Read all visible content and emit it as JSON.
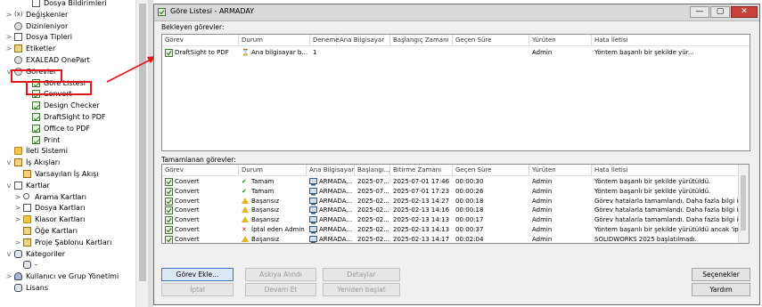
{
  "tree": {
    "items": [
      {
        "name": "dosya-bildirimleri",
        "label": "Dosya Bildirimleri",
        "arrow": "",
        "icon": "ic-page",
        "icon_name": "file-notifications-icon"
      },
      {
        "name": "degiskenler",
        "label": "Değişkenler",
        "arrow": ">",
        "icon": "ic-var",
        "icon_name": "variables-icon",
        "glyph": "(x)"
      },
      {
        "name": "dizinleniyor",
        "label": "Dizinleniyor",
        "arrow": "",
        "icon": "ic-gear",
        "icon_name": "indexing-icon"
      },
      {
        "name": "dosya-tipleri",
        "label": "Dosya Tipleri",
        "arrow": ">",
        "icon": "ic-page",
        "icon_name": "file-types-icon"
      },
      {
        "name": "etiketler",
        "label": "Etiketler",
        "arrow": ">",
        "icon": "ic-card",
        "icon_name": "labels-icon"
      },
      {
        "name": "exalead",
        "label": "EXALEAD OnePart",
        "arrow": "",
        "icon": "ic-gear",
        "icon_name": "exalead-icon"
      },
      {
        "name": "gorevler",
        "label": "Görevler",
        "arrow": "v",
        "icon": "ic-gear",
        "icon_name": "tasks-gear-icon"
      },
      {
        "name": "gore-listesi",
        "label": "Göre Listesi",
        "arrow": "",
        "icon": "ic-task",
        "icon_name": "task-list-icon"
      },
      {
        "name": "convert",
        "label": "Convert",
        "arrow": "",
        "icon": "ic-task",
        "icon_name": "convert-task-icon"
      },
      {
        "name": "design-checker",
        "label": "Design Checker",
        "arrow": "",
        "icon": "ic-task",
        "icon_name": "design-checker-icon"
      },
      {
        "name": "draftsight-pdf",
        "label": "DraftSight to PDF",
        "arrow": "",
        "icon": "ic-task",
        "icon_name": "draftsight-pdf-icon"
      },
      {
        "name": "office-pdf",
        "label": "Office to PDF",
        "arrow": "",
        "icon": "ic-task",
        "icon_name": "office-pdf-icon"
      },
      {
        "name": "print",
        "label": "Print",
        "arrow": "",
        "icon": "ic-task",
        "icon_name": "print-task-icon"
      },
      {
        "name": "ileti-sistemi",
        "label": "İleti Sistemi",
        "arrow": "",
        "icon": "ic-folder",
        "icon_name": "message-system-icon"
      },
      {
        "name": "is-akislari",
        "label": "İş Akışları",
        "arrow": "v",
        "icon": "ic-flow",
        "icon_name": "workflows-icon"
      },
      {
        "name": "varsayilan-akis",
        "label": "Varsayılan İş Akışı",
        "arrow": "",
        "icon": "ic-flow",
        "icon_name": "default-workflow-icon"
      },
      {
        "name": "kartlar",
        "label": "Kartlar",
        "arrow": "v",
        "icon": "ic-box",
        "icon_name": "cards-icon"
      },
      {
        "name": "arama-kartlari",
        "label": "Arama Kartları",
        "arrow": ">",
        "icon": "ic-search",
        "icon_name": "search-cards-icon"
      },
      {
        "name": "dosya-kartlari",
        "label": "Dosya Kartları",
        "arrow": ">",
        "icon": "ic-page",
        "icon_name": "file-cards-icon"
      },
      {
        "name": "klasor-kartlari",
        "label": "Klasor Kartları",
        "arrow": ">",
        "icon": "ic-folder",
        "icon_name": "folder-cards-icon"
      },
      {
        "name": "oge-kartlari",
        "label": "Öğe Kartları",
        "arrow": "",
        "icon": "ic-card",
        "icon_name": "item-cards-icon"
      },
      {
        "name": "proje-sablonu",
        "label": "Proje Şablonu Kartları",
        "arrow": ">",
        "icon": "ic-card",
        "icon_name": "project-template-icon"
      },
      {
        "name": "kategoriler",
        "label": "Kategoriler",
        "arrow": "v",
        "icon": "ic-db",
        "icon_name": "categories-icon"
      },
      {
        "name": "kategori-dash",
        "label": "-",
        "arrow": "",
        "icon": "ic-db",
        "icon_name": "category-icon"
      },
      {
        "name": "kullanici-grup",
        "label": "Kullanıcı ve Grup Yönetimi",
        "arrow": ">",
        "icon": "ic-user",
        "icon_name": "users-groups-icon"
      },
      {
        "name": "lisans",
        "label": "Lisans",
        "arrow": "",
        "icon": "ic-db",
        "icon_name": "license-icon"
      }
    ]
  },
  "window": {
    "title": "Göre Listesi - ARMADAY",
    "btn_min": "—",
    "btn_max": "▢",
    "btn_close": "✕"
  },
  "pending": {
    "label": "Bekleyen görevler:",
    "columns": [
      "Görev",
      "Durum",
      "Deneme",
      "Ana Bilgisayar",
      "Başlangıç Zamanı",
      "Geçen Süre",
      "Yürüten",
      "Hata İletisi"
    ],
    "rows": [
      {
        "task": "DraftSight to PDF",
        "status": "Ana bilgisayar b...",
        "attempt": "1",
        "host": "",
        "start": "",
        "elapsed": "",
        "user": "Admin",
        "error": "Yöntem başarılı bir şekilde yür..."
      }
    ]
  },
  "completed": {
    "label": "Tamamlanan görevler:",
    "columns": [
      "Görev",
      "Durum",
      "Ana Bilgisayar",
      "Başlangı...",
      "Bitirme Zamanı",
      "Geçen Süre",
      "Yürüten",
      "Hata İletisi"
    ],
    "rows": [
      {
        "task": "Convert",
        "status": "Tamam",
        "kind": "ok",
        "host": "ARMADA...",
        "start": "2025-07...",
        "end": "2025-07-01 17:46",
        "elapsed": "00:00:30",
        "user": "Admin",
        "error": "Yöntem başarılı bir şekilde yürütüldü."
      },
      {
        "task": "Convert",
        "status": "Tamam",
        "kind": "ok",
        "host": "ARMADA...",
        "start": "2025-07...",
        "end": "2025-07-01 17:23",
        "elapsed": "00:00:26",
        "user": "Admin",
        "error": "Yöntem başarılı bir şekilde yürütüldü."
      },
      {
        "task": "Convert",
        "status": "Başarısız",
        "kind": "warn",
        "host": "ARMADA...",
        "start": "2025-02...",
        "end": "2025-02-13 14:27",
        "elapsed": "00:00:18",
        "user": "Admin",
        "error": "Görev hatalarla tamamlandı. Daha fazla bilgi için"
      },
      {
        "task": "Convert",
        "status": "Başarısız",
        "kind": "warn",
        "host": "ARMADA...",
        "start": "2025-02...",
        "end": "2025-02-13 14:16",
        "elapsed": "00:00:18",
        "user": "Admin",
        "error": "Görev hatalarla tamamlandı. Daha fazla bilgi için"
      },
      {
        "task": "Convert",
        "status": "Başarısız",
        "kind": "warn",
        "host": "ARMADA...",
        "start": "2025-02...",
        "end": "2025-02-13 14:13",
        "elapsed": "00:00:17",
        "user": "Admin",
        "error": "Görev hatalarla tamamlandı. Daha fazla bilgi için"
      },
      {
        "task": "Convert",
        "status": "İptal eden Admin",
        "kind": "x",
        "host": "ARMADA...",
        "start": "2025-02...",
        "end": "2025-02-13 14:13",
        "elapsed": "00:00:37",
        "user": "Admin",
        "error": "Yöntem başarılı bir şekilde yürütüldü ancak 'iptal'"
      },
      {
        "task": "Convert",
        "status": "Başarısız",
        "kind": "warn",
        "host": "ARMADA...",
        "start": "2025-02...",
        "end": "2025-02-13 14:17",
        "elapsed": "00:02:04",
        "user": "Admin",
        "error": "SOLIDWORKS 2025 başlatılmadı."
      }
    ]
  },
  "buttons": {
    "gorev_ekle": "Görev Ekle...",
    "askiya_al": "Askıya Alındı",
    "detaylar": "Detaylar",
    "iptal": "İptal",
    "devam_et": "Devam Et",
    "yeniden_baslat": "Yeniden başlat",
    "secenekler": "Seçenekler",
    "yardim": "Yardım"
  },
  "colors": {
    "annotation": "#e4141b",
    "ok": "#1e8a2c",
    "warn": "#e6b421",
    "cancel": "#d02020"
  }
}
